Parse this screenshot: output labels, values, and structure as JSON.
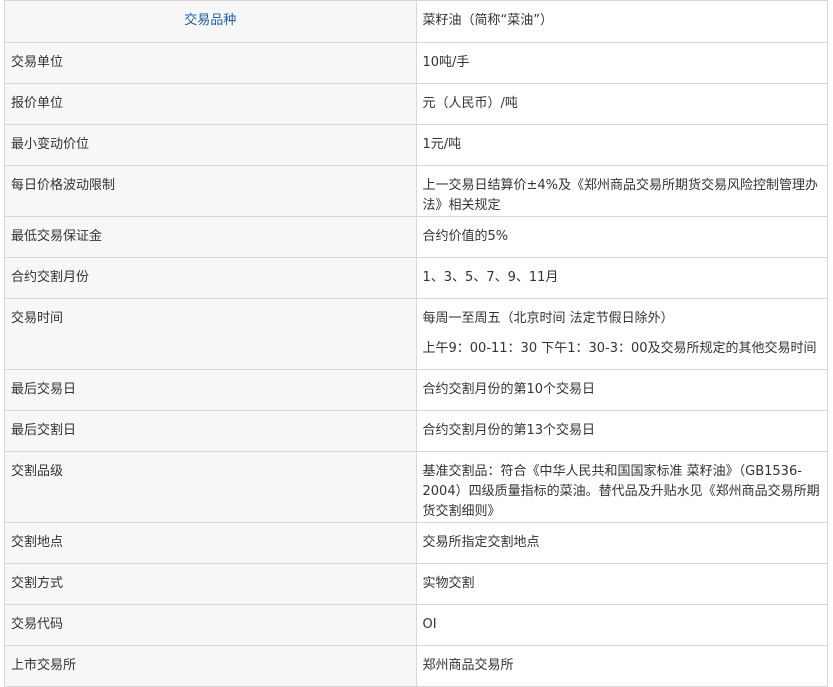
{
  "header": {
    "key": "交易品种",
    "value": "菜籽油（简称“菜油”）"
  },
  "rows": [
    {
      "key": "交易单位",
      "value": [
        "10吨/手"
      ]
    },
    {
      "key": "报价单位",
      "value": [
        "元（人民币）/吨"
      ]
    },
    {
      "key": "最小变动价位",
      "value": [
        "1元/吨"
      ]
    },
    {
      "key": "每日价格波动限制",
      "value": [
        "上一交易日结算价±4%及《郑州商品交易所期货交易风险控制管理办法》相关规定"
      ]
    },
    {
      "key": "最低交易保证金",
      "value": [
        "合约价值的5%"
      ]
    },
    {
      "key": "合约交割月份",
      "value": [
        "1、3、5、7、9、11月"
      ]
    },
    {
      "key": "交易时间",
      "value": [
        "每周一至周五（北京时间 法定节假日除外）",
        "上午9：00-11：30 下午1：30-3：00及交易所规定的其他交易时间"
      ]
    },
    {
      "key": "最后交易日",
      "value": [
        "合约交割月份的第10个交易日"
      ]
    },
    {
      "key": "最后交割日",
      "value": [
        "合约交割月份的第13个交易日"
      ]
    },
    {
      "key": "交割品级",
      "value": [
        "基准交割品：符合《中华人民共和国国家标准 菜籽油》（GB1536-2004）四级质量指标的菜油。替代品及升贴水见《郑州商品交易所期货交割细则》"
      ]
    },
    {
      "key": "交割地点",
      "value": [
        "交易所指定交割地点"
      ]
    },
    {
      "key": "交割方式",
      "value": [
        "实物交割"
      ]
    },
    {
      "key": "交易代码",
      "value": [
        "OI"
      ]
    },
    {
      "key": "上市交易所",
      "value": [
        "郑州商品交易所"
      ]
    }
  ]
}
